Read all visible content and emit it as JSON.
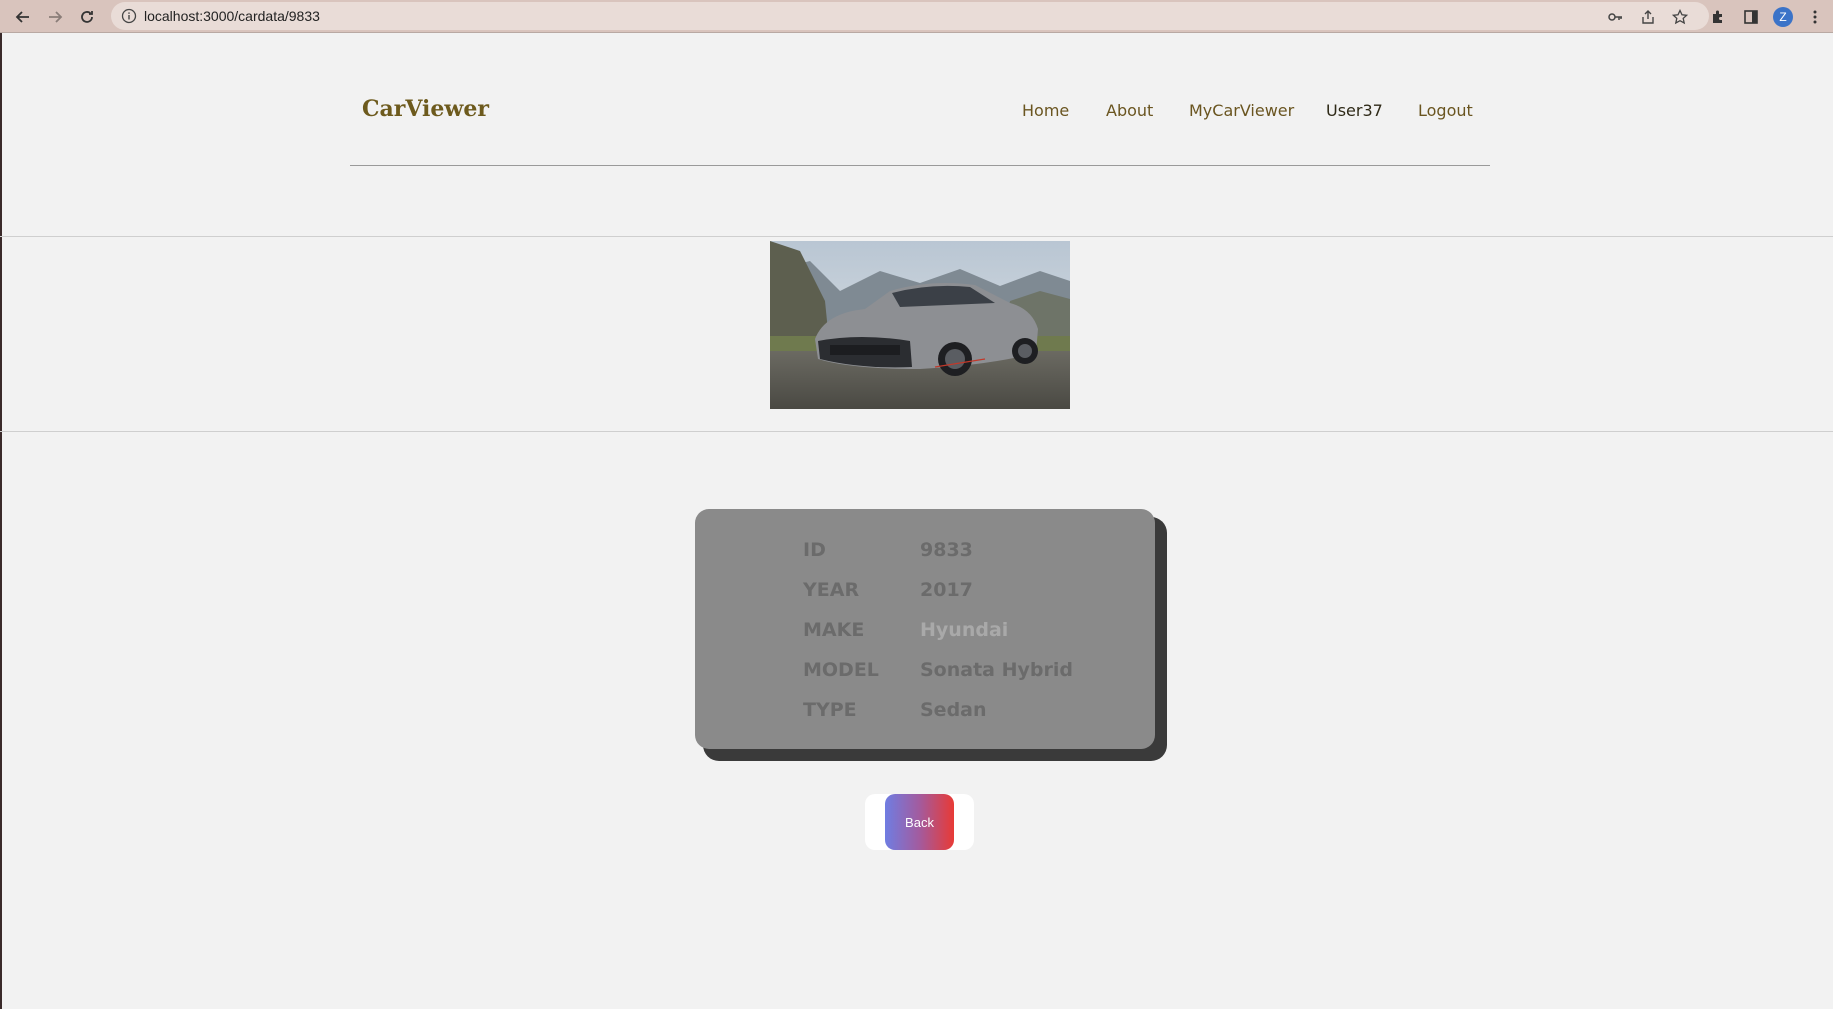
{
  "browser": {
    "url": "localhost:3000/cardata/9833",
    "profile_initial": "Z"
  },
  "site": {
    "brand": "CarViewer",
    "nav": {
      "home": "Home",
      "about": "About",
      "mycarviewer": "MyCarViewer",
      "user": "User37",
      "logout": "Logout"
    }
  },
  "car": {
    "image_alt": "Gray sedan parked in front of mountains",
    "fields": {
      "id_label": "ID",
      "id_value": "9833",
      "year_label": "YEAR",
      "year_value": "2017",
      "make_label": "MAKE",
      "make_value": "Hyundai",
      "model_label": "MODEL",
      "model_value": "Sonata Hybrid",
      "type_label": "TYPE",
      "type_value": "Sedan"
    }
  },
  "actions": {
    "back_label": "Back"
  },
  "colors": {
    "brand": "#6d5a1d",
    "card": "#8a8a8a",
    "button_gradient_start": "#6f7de2",
    "button_gradient_end": "#e83a35"
  }
}
